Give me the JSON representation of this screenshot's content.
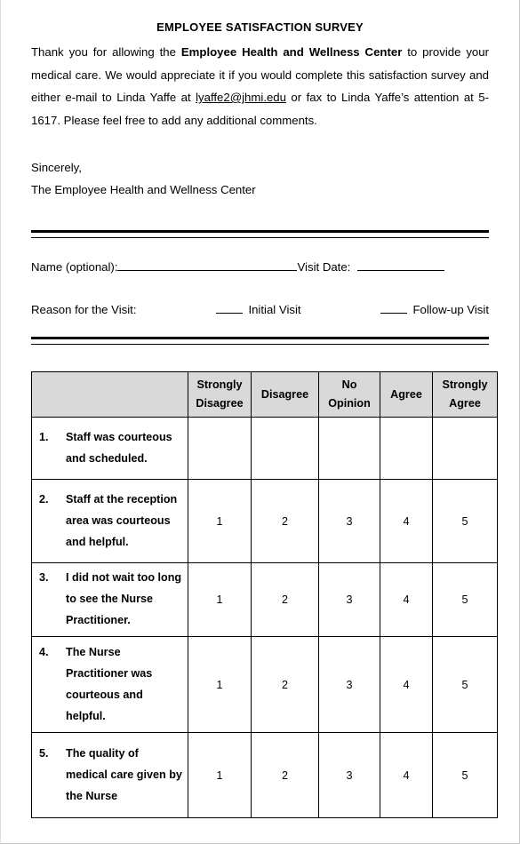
{
  "document": {
    "title": "EMPLOYEE SATISFACTION SURVEY",
    "intro": {
      "part1": "Thank you for allowing the ",
      "bold1": "Employee Health and Wellness Center",
      "part2": " to provide your medical care. We would appreciate it if you would complete this satisfaction survey and either e-mail to Linda Yaffe at ",
      "email": "lyaffe2@jhmi.edu",
      "part3": " or fax to Linda Yaffe’s attention at 5-1617. Please feel free to add any additional comments."
    },
    "signoff": {
      "closing": "Sincerely,",
      "signer": "The Employee Health and Wellness Center"
    },
    "fields": {
      "name_label": "Name (optional):",
      "name_value": "",
      "name_placeholder": "",
      "visit_date_label": "Visit Date:",
      "visit_date_value": "",
      "reason_label": "Reason for the Visit:",
      "initial_visit_label": "Initial Visit",
      "initial_visit_checked": "",
      "followup_visit_label": "Follow-up Visit",
      "followup_visit_checked": ""
    },
    "colors": {
      "header_fill": "#d9d9d9",
      "rule": "#000000",
      "text": "#000000",
      "page_border": "#c8c8c8"
    }
  },
  "table": {
    "headers": [
      "",
      "Strongly Disagree",
      "Disagree",
      "No Opinion",
      "Agree",
      "Strongly Agree"
    ],
    "header_lines": [
      [
        "",
        ""
      ],
      [
        "Strongly",
        "Disagree"
      ],
      [
        "Disagree",
        ""
      ],
      [
        "No",
        "Opinion"
      ],
      [
        "Agree",
        ""
      ],
      [
        "Strongly",
        "Agree"
      ]
    ],
    "rows": [
      {
        "num": "1.",
        "question": "Staff was courteous and scheduled.",
        "values": [
          "",
          "",
          "",
          "",
          ""
        ]
      },
      {
        "num": "2.",
        "question": "Staff at the reception area was courteous and helpful.",
        "values": [
          "1",
          "2",
          "3",
          "4",
          "5"
        ]
      },
      {
        "num": "3.",
        "question": "I did not wait too long to see the Nurse Practitioner.",
        "values": [
          "1",
          "2",
          "3",
          "4",
          "5"
        ]
      },
      {
        "num": "4.",
        "question": "The Nurse Practitioner was courteous and helpful.",
        "values": [
          "1",
          "2",
          "3",
          "4",
          "5"
        ]
      },
      {
        "num": "5.",
        "question": "The quality of medical care given by the Nurse",
        "values": [
          "1",
          "2",
          "3",
          "4",
          "5"
        ]
      }
    ]
  }
}
